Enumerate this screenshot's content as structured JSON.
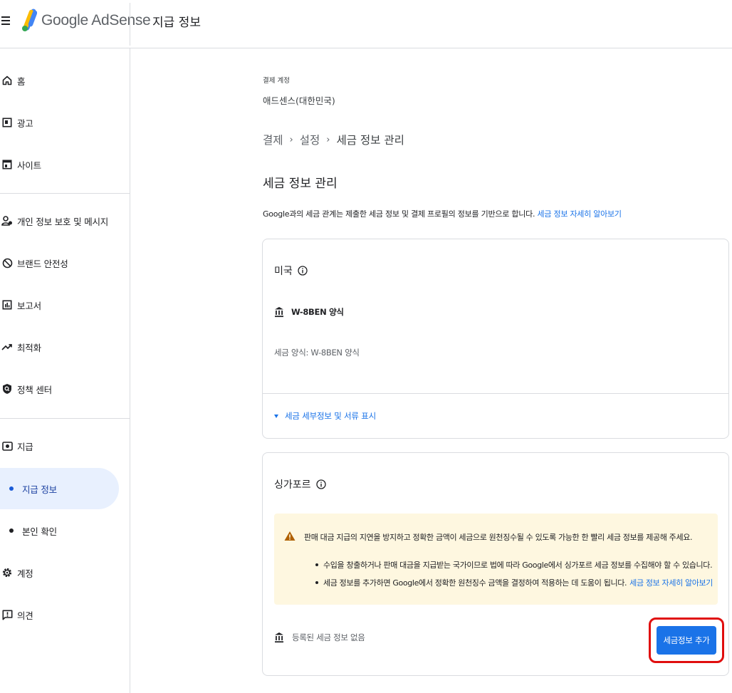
{
  "header": {
    "brand": "Google AdSense",
    "title": "지급 정보"
  },
  "sidebar": {
    "items": [
      {
        "label": "홈"
      },
      {
        "label": "광고"
      },
      {
        "label": "사이트"
      },
      {
        "label": "개인 정보 보호 및 메시지"
      },
      {
        "label": "브랜드 안전성"
      },
      {
        "label": "보고서"
      },
      {
        "label": "최적화"
      },
      {
        "label": "정책 센터"
      },
      {
        "label": "지급"
      },
      {
        "label": "지급 정보"
      },
      {
        "label": "본인 확인"
      },
      {
        "label": "계정"
      },
      {
        "label": "의견"
      }
    ]
  },
  "main": {
    "account_label": "결제 계정",
    "account_value": "애드센스(대한민국)",
    "breadcrumb": [
      "결제",
      "설정",
      "세금 정보 관리"
    ],
    "page_title": "세금 정보 관리",
    "description": "Google과의 세금 관계는 제출한 세금 정보 및 결제 프로필의 정보를 기반으로 합니다.",
    "description_link": "세금 정보 자세히 알아보기",
    "us_card": {
      "title": "미국",
      "form_name": "W-8BEN 양식",
      "form_type": "세금 양식: W-8BEN 양식",
      "toggle": "세금 세부정보 및 서류 표시"
    },
    "sg_card": {
      "title": "싱가포르",
      "warning": "판매 대금 지급의 지연을 방지하고 정확한 금액이 세금으로 원천징수될 수 있도록 가능한 한 빨리 세금 정보를 제공해 주세요.",
      "bullets": [
        "수입을 창출하거나 판매 대금을 지급받는 국가이므로 법에 따라 Google에서 싱가포르 세금 정보를 수집해야 할 수 있습니다.",
        "세금 정보를 추가하면 Google에서 정확한 원천징수 금액을 결정하여 적용하는 데 도움이 됩니다."
      ],
      "bullet_link": "세금 정보 자세히 알아보기",
      "no_info": "등록된 세금 정보 없음",
      "add_button": "세금정보 추가"
    }
  },
  "colors": {
    "accent": "#1a73e8",
    "warning_bg": "#fef7e0",
    "warning_icon": "#b06000",
    "highlight_ring": "#e00e0e",
    "active_nav_bg": "#e8f0fe"
  },
  "icons": {
    "home": "home-icon",
    "ads": "ads-icon",
    "sites": "sites-icon",
    "privacy": "privacy-icon",
    "brand_safety": "block-icon",
    "reports": "reports-icon",
    "optimization": "trending-icon",
    "policy": "policy-icon",
    "payments": "payments-icon",
    "account": "gear-icon",
    "feedback": "feedback-icon",
    "tax_form": "bank-icon",
    "info": "info-icon",
    "warning": "warning-icon"
  }
}
